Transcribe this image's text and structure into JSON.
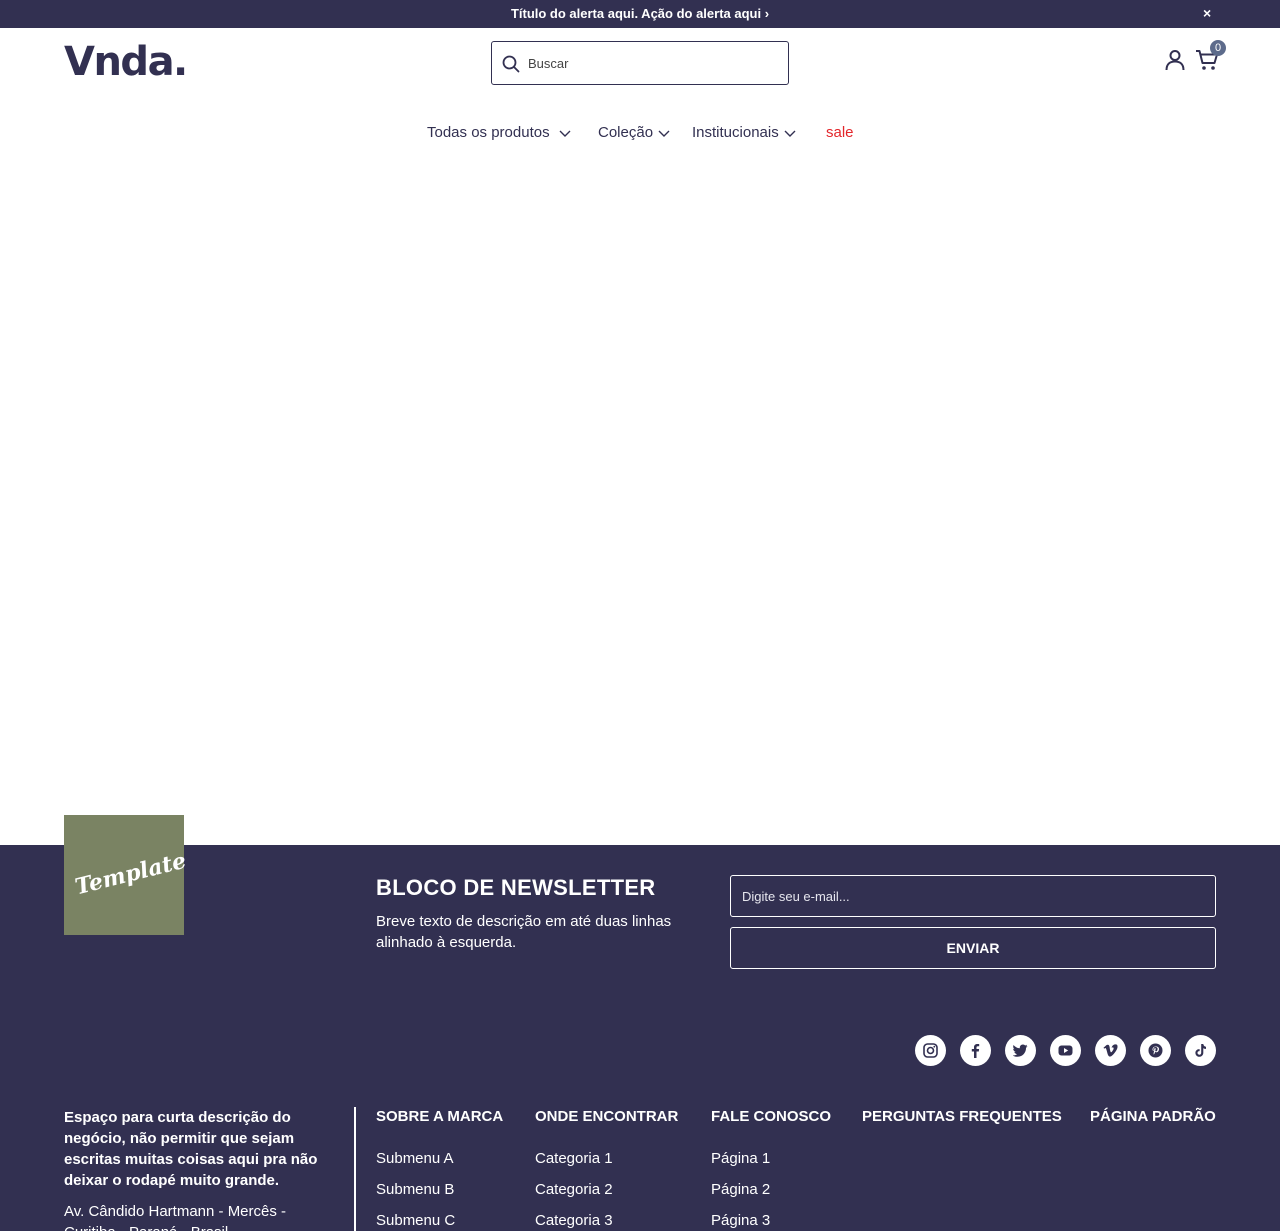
{
  "alert": {
    "text": "Título do alerta aqui. Ação do alerta aqui ›",
    "close": "×"
  },
  "header": {
    "logo": "Vnda.",
    "search_placeholder": "Buscar",
    "cart_count": "0"
  },
  "nav": {
    "items": [
      {
        "label": "Todas os produtos"
      },
      {
        "label": "Coleção"
      },
      {
        "label": "Institucionais"
      },
      {
        "label": "sale"
      }
    ]
  },
  "colors": {
    "primary": "#323051",
    "sale": "#e3262b",
    "template_logo_bg": "#7a8363",
    "badge": "#5d6b8b"
  },
  "footer": {
    "template_logo": "Template",
    "newsletter": {
      "title": "BLOCO DE NEWSLETTER",
      "description": "Breve texto de descrição em até duas linhas alinhado à esquerda.",
      "email_placeholder": "Digite seu e-mail...",
      "submit_label": "ENVIAR"
    },
    "social": [
      "instagram-icon",
      "facebook-icon",
      "twitter-icon",
      "youtube-icon",
      "vimeo-icon",
      "pinterest-icon",
      "tiktok-icon"
    ],
    "business_description": "Espaço para curta descrição do negócio, não permitir que sejam escritas muitas coisas aqui pra não deixar o rodapé muito grande.",
    "address": "Av. Cândido Hartmann - Mercês - Curitiba - Paraná - Brasil",
    "columns": [
      {
        "title": "SOBRE A MARCA",
        "links": [
          "Submenu A",
          "Submenu B",
          "Submenu C"
        ]
      },
      {
        "title": "ONDE ENCONTRAR",
        "links": [
          "Categoria 1",
          "Categoria 2",
          "Categoria 3"
        ]
      },
      {
        "title": "FALE CONOSCO",
        "links": [
          "Página 1",
          "Página 2",
          "Página 3"
        ]
      },
      {
        "title": "PERGUNTAS FREQUENTES",
        "links": []
      },
      {
        "title": "PÁGINA PADRÃO",
        "links": []
      }
    ]
  }
}
